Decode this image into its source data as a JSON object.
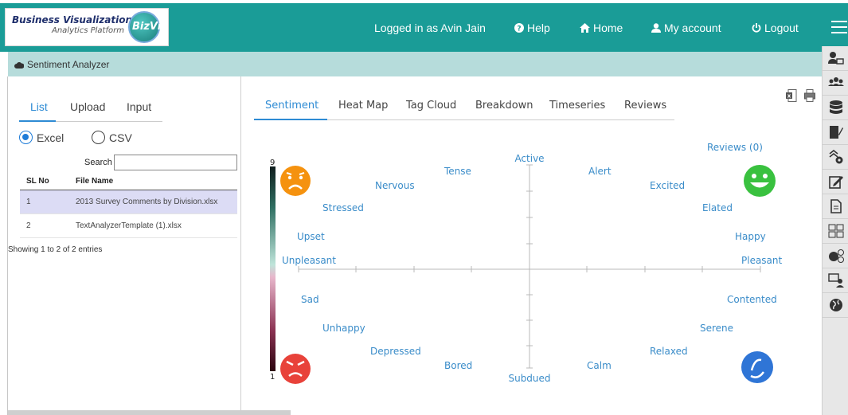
{
  "app": {
    "logo_title": "Business Visualization",
    "logo_subtitle": "Analytics Platform",
    "logo_mark": "BizViz"
  },
  "header": {
    "logged_in": "Logged in as Avin Jain",
    "help": "Help",
    "home": "Home",
    "account": "My account",
    "logout": "Logout"
  },
  "breadcrumb": {
    "title": "Sentiment Analyzer"
  },
  "left": {
    "tabs": [
      "List",
      "Upload",
      "Input"
    ],
    "radio": {
      "excel": "Excel",
      "csv": "CSV",
      "selected": "Excel"
    },
    "search_label": "Search",
    "search_value": "",
    "table": {
      "headers": [
        "SL No",
        "File Name"
      ],
      "rows": [
        {
          "sl": "1",
          "name": "2013 Survey Comments by Division.xlsx",
          "selected": true
        },
        {
          "sl": "2",
          "name": "TextAnalyzerTemplate (1).xlsx",
          "selected": false
        }
      ]
    },
    "entries": "Showing 1 to 2 of 2 entries"
  },
  "right": {
    "tabs": [
      "Sentiment",
      "Heat Map",
      "Tag Cloud",
      "Breakdown",
      "Timeseries",
      "Reviews"
    ],
    "reviews": "Reviews (0)",
    "scale_max": "9",
    "scale_min": "1",
    "labels": {
      "active": "Active",
      "alert": "Alert",
      "tense": "Tense",
      "nervous": "Nervous",
      "excited": "Excited",
      "stressed": "Stressed",
      "elated": "Elated",
      "upset": "Upset",
      "happy": "Happy",
      "unpleasant": "Unpleasant",
      "pleasant": "Pleasant",
      "sad": "Sad",
      "contented": "Contented",
      "unhappy": "Unhappy",
      "serene": "Serene",
      "depressed": "Depressed",
      "relaxed": "Relaxed",
      "bored": "Bored",
      "calm": "Calm",
      "subdued": "Subdued"
    }
  },
  "colors": {
    "header_bg": "#1a9c97",
    "crumb_bg": "#b6dcdb",
    "accent": "#2e8bd4",
    "label": "#3a8cc9"
  },
  "icons": {
    "help": "question-circle-icon",
    "home": "home-icon",
    "account": "user-icon",
    "logout": "power-icon",
    "menu": "hamburger-icon",
    "breadcrumb": "cloud-icon"
  }
}
